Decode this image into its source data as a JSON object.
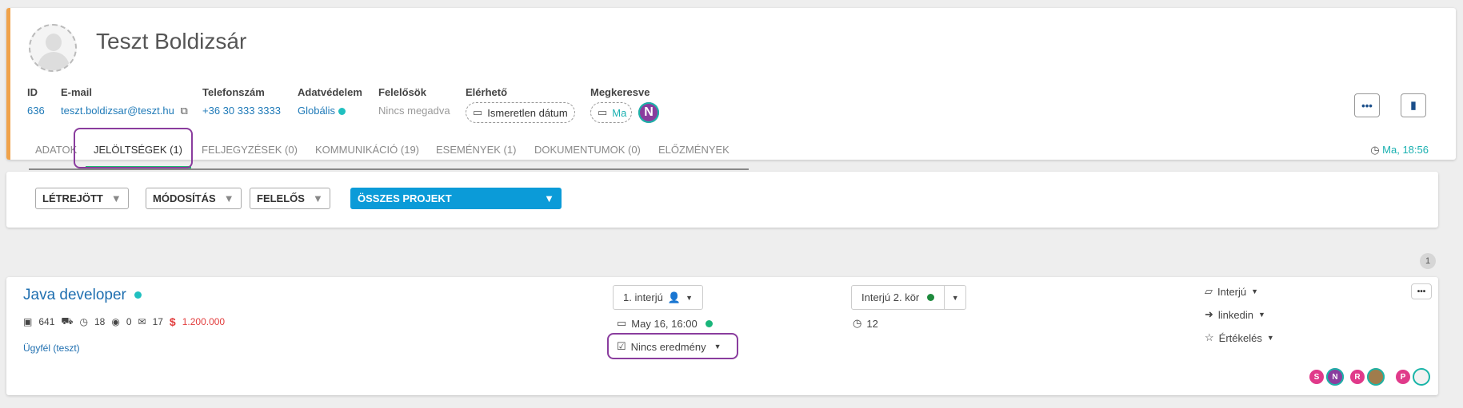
{
  "header": {
    "name": "Teszt Boldizsár",
    "fields": {
      "id": {
        "label": "ID",
        "value": "636"
      },
      "email": {
        "label": "E-mail",
        "value": "teszt.boldizsar@teszt.hu"
      },
      "phone": {
        "label": "Telefonszám",
        "value": "+36 30 333 3333"
      },
      "privacy": {
        "label": "Adatvédelem",
        "value": "Globális"
      },
      "responsible": {
        "label": "Felelősök",
        "value": "Nincs megadva"
      },
      "available": {
        "label": "Elérhető",
        "value": "Ismeretlen dátum"
      },
      "contacted": {
        "label": "Megkeresve",
        "value": "Ma",
        "avatar": "N"
      }
    },
    "more_icon": "ellipsis-icon",
    "bookmark_icon": "bookmark-icon",
    "timestamp": "Ma, 18:56",
    "tabs": [
      {
        "label": "ADATOK"
      },
      {
        "label": "JELÖLTSÉGEK (1)"
      },
      {
        "label": "FELJEGYZÉSEK (0)"
      },
      {
        "label": "KOMMUNIKÁCIÓ (19)"
      },
      {
        "label": "ESEMÉNYEK (1)"
      },
      {
        "label": "DOKUMENTUMOK (0)"
      },
      {
        "label": "ELŐZMÉNYEK"
      }
    ],
    "active_tab": "JELÖLTSÉGEK (1)"
  },
  "filters": {
    "created": "LÉTREJÖTT",
    "modified": "MÓDOSÍTÁS",
    "responsible": "FELELŐS",
    "project": "ÖSSZES PROJEKT"
  },
  "result_count": "1",
  "project": {
    "title": "Java developer",
    "stats": {
      "id": "641",
      "count_a": "18",
      "views": "0",
      "messages": "17",
      "salary": "1.200.000"
    },
    "client": "Ügyfél (teszt)",
    "stage": "1. interjú",
    "date": "May 16, 16:00",
    "result": "Nincs eredmény",
    "status": "Interjú 2. kör",
    "status_count": "12",
    "tags": {
      "type": "Interjú",
      "source": "linkedin",
      "rating": "Értékelés"
    },
    "avatars": [
      "S",
      "N",
      "R",
      "",
      "P",
      ""
    ]
  },
  "colors": {
    "accent_orange": "#f0a24a",
    "link_blue": "#1f7ab8",
    "primary_filter": "#0b9bd8",
    "active_tab_underline": "#1cb86e",
    "highlight_purple": "#8a3d9e",
    "salary_red": "#e23d3d"
  }
}
